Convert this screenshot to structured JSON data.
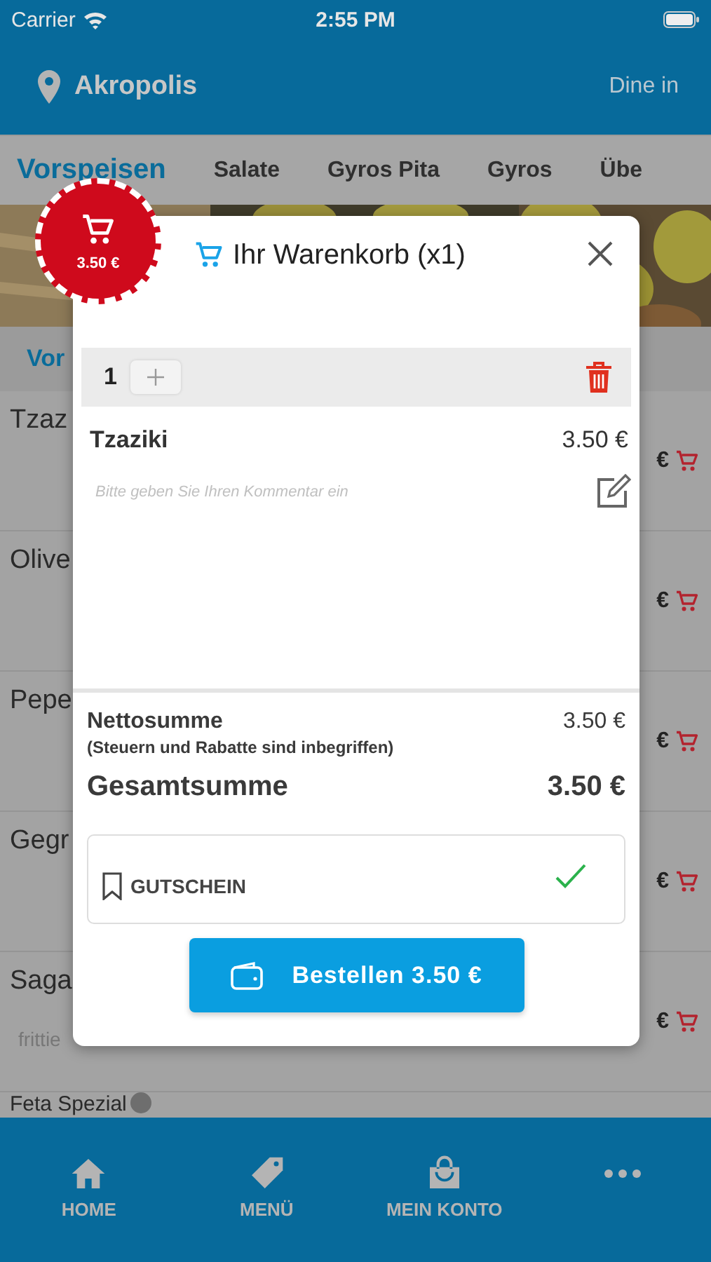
{
  "status_bar": {
    "carrier": "Carrier",
    "time": "2:55 PM"
  },
  "header": {
    "location": "Akropolis",
    "mode": "Dine in"
  },
  "tabs": [
    {
      "label": "Vorspeisen",
      "selected": true
    },
    {
      "label": "Salate",
      "selected": false
    },
    {
      "label": "Gyros Pita",
      "selected": false
    },
    {
      "label": "Gyros",
      "selected": false
    },
    {
      "label": "Übe",
      "selected": false
    }
  ],
  "section_title": "Vor",
  "menu_items": [
    {
      "name": "Tzaz",
      "price": "€"
    },
    {
      "name": "Olive",
      "price": "€"
    },
    {
      "name": "Pepe",
      "price": "€"
    },
    {
      "name": "Gegr",
      "price": "€"
    },
    {
      "name": "Saga",
      "description": "frittie",
      "price": "€"
    },
    {
      "name": "Feta Spezial"
    }
  ],
  "cart_badge": {
    "price": "3.50 €"
  },
  "cart": {
    "title": "Ihr Warenkorb (x1)",
    "quantity": "1",
    "item_name": "Tzaziki",
    "item_price": "3.50 €",
    "comment_placeholder": "Bitte geben Sie Ihren Kommentar ein",
    "net_label": "Nettosumme",
    "net_value": "3.50 €",
    "tax_note": "(Steuern und Rabatte sind inbegriffen)",
    "total_label": "Gesamtsumme",
    "total_value": "3.50 €",
    "voucher_label": "GUTSCHEIN",
    "voucher_applied": true,
    "order_button": "Bestellen 3.50 €"
  },
  "tab_bar": [
    {
      "kind": "home",
      "label": "HOME"
    },
    {
      "kind": "tag",
      "label": "MENÜ"
    },
    {
      "kind": "bag",
      "label": "MEIN KONTO"
    },
    {
      "kind": "more"
    }
  ]
}
